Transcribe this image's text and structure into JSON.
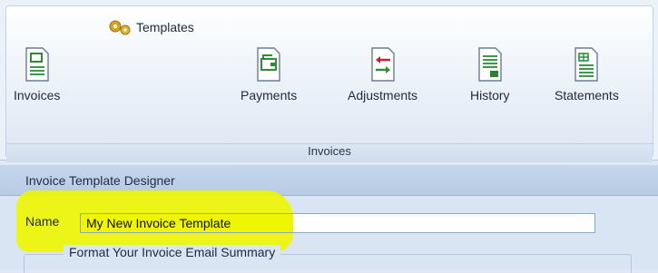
{
  "ribbon": {
    "templates_label": "Templates",
    "buttons": [
      {
        "label": "Invoices",
        "icon": "invoice-document-icon"
      },
      {
        "label": "Payments",
        "icon": "payment-document-icon"
      },
      {
        "label": "Adjustments",
        "icon": "adjustment-arrows-icon"
      },
      {
        "label": "History",
        "icon": "history-document-icon"
      },
      {
        "label": "Statements",
        "icon": "statement-document-icon"
      }
    ],
    "group_label": "Invoices"
  },
  "designer": {
    "title": "Invoice Template Designer",
    "name_label": "Name",
    "name_value": "My New Invoice Template",
    "fieldset_legend": "Format Your Invoice Email Summary",
    "highlight_color": "#eef600"
  }
}
